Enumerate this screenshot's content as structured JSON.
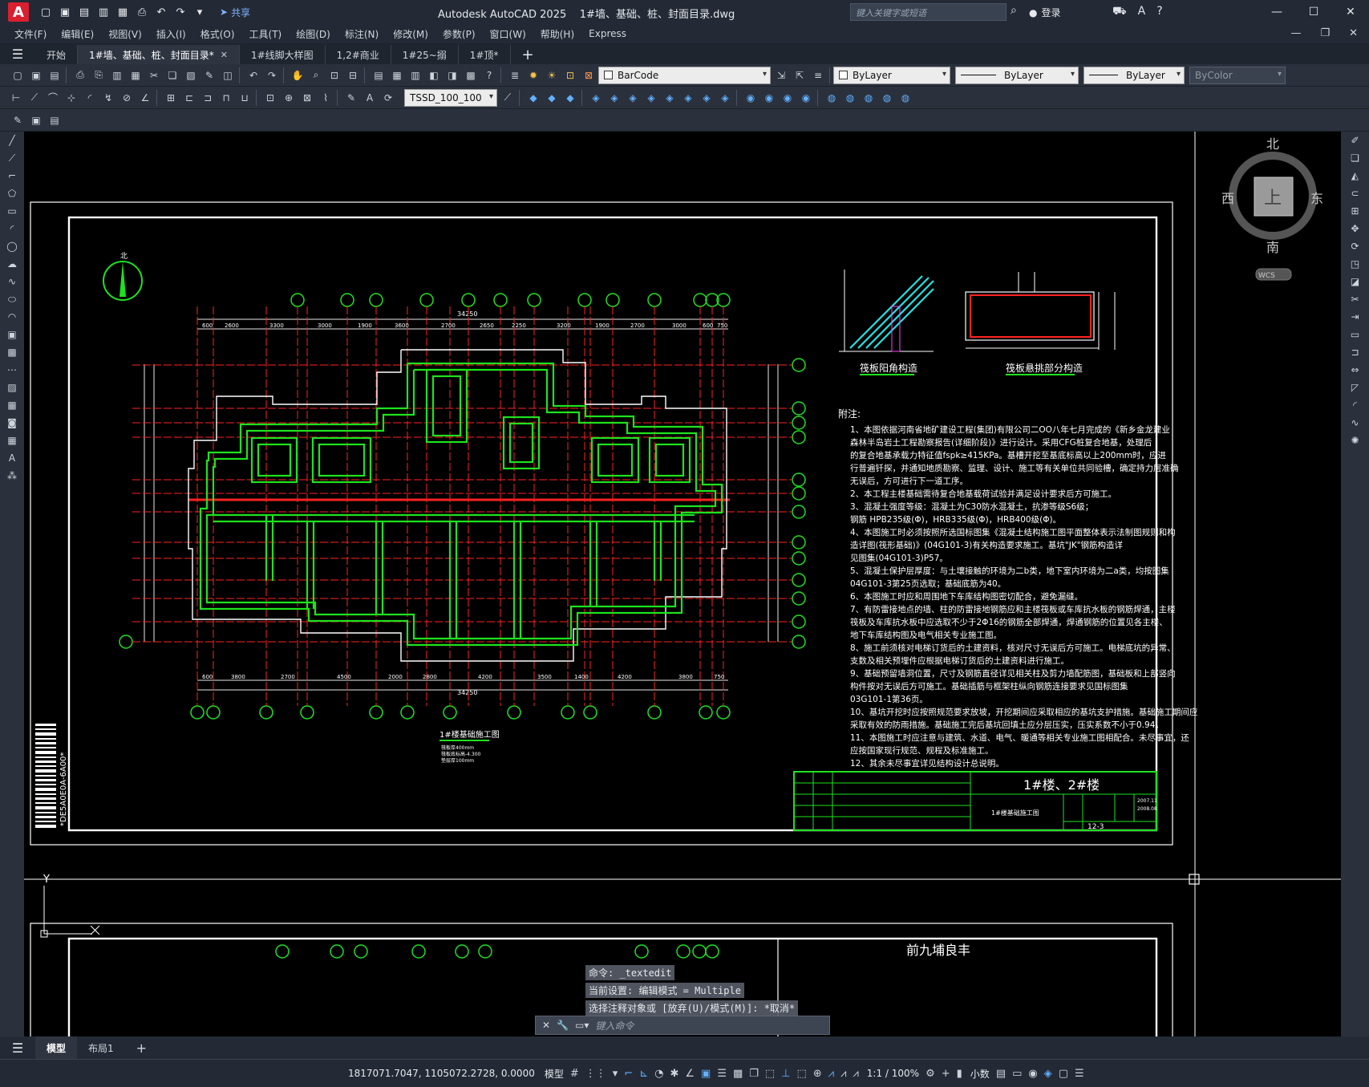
{
  "app": {
    "name": "Autodesk AutoCAD 2025",
    "file": "1#墙、基础、桩、封面目录.dwg",
    "logo_letter": "A"
  },
  "titlebar": {
    "share_label": "共享",
    "search_placeholder": "键入关键字或短语",
    "login_label": "登录"
  },
  "menu": [
    "文件(F)",
    "编辑(E)",
    "视图(V)",
    "插入(I)",
    "格式(O)",
    "工具(T)",
    "绘图(D)",
    "标注(N)",
    "修改(M)",
    "参数(P)",
    "窗口(W)",
    "帮助(H)",
    "Express"
  ],
  "tabs": [
    {
      "label": "开始",
      "active": false
    },
    {
      "label": "1#墙、基础、桩、封面目录*",
      "active": true
    },
    {
      "label": "1#线脚大样图",
      "active": false
    },
    {
      "label": "1,2#商业",
      "active": false
    },
    {
      "label": "1#25~搦",
      "active": false
    },
    {
      "label": "1#顶*",
      "active": false
    }
  ],
  "toolbar": {
    "layer_name": "BarCode",
    "color": "ByLayer",
    "linetype": "ByLayer",
    "lineweight": "ByLayer",
    "plotstyle": "ByColor",
    "dimstyle": "TSSD_100_100"
  },
  "viewcube": {
    "north": "北",
    "south": "南",
    "east": "东",
    "west": "西",
    "face": "上",
    "wcs": "WCS"
  },
  "drawing": {
    "plan_title": "1#楼基础施工图",
    "plan_notes": [
      "筏板厚400mm",
      "筏板底标高-4.300",
      "垫层厚100mm"
    ],
    "total_dim": "34250",
    "detail1_title": "筏板阳角构造",
    "detail2_title": "筏板悬挑部分构造",
    "notes_heading": "附注:",
    "notes": [
      "1、本图依据河南省地矿建设工程(集团)有限公司二OO八年七月完成的《新乡金龙建业",
      "     森林半岛岩土工程勘察报告(详细阶段)》进行设计。采用CFG桩复合地基，处理后",
      "     的复合地基承载力特征值fspk≥415KPa。基槽开挖至基底标高以上200mm时，应进",
      "     行普遍钎探，并通知地质勘察、监理、设计、施工等有关单位共同验槽，确定持力层准确",
      "     无误后，方可进行下一道工序。",
      "2、本工程主楼基础需待复合地基载荷试验并满足设计要求后方可施工。",
      "3、混凝土强度等级：混凝土为C30防水混凝土，抗渗等级S6级；",
      "     钢筋 HPB235级(Φ)，HRB335级(Φ)，HRB400级(Φ)。",
      "4、本图施工时必须按照所选国标图集《混凝土结构施工图平面整体表示法制图规则和构",
      "     造详图(筏形基础)》(04G101-3)有关构造要求施工。基坑\"JK\"钢筋构造详",
      "     见图集(04G101-3)P57。",
      "5、混凝土保护层厚度：与土壤接触的环境为二b类，地下室内环境为二a类，均按图集",
      "     04G101-3第25页选取；基础底筋为40。",
      "6、本图施工时应和周围地下车库结构图密切配合，避免漏缝。",
      "7、有防雷接地点的墙、柱的防雷接地钢筋应和主楼筏板或车库抗水板的钢筋焊通，主楼",
      "     筏板及车库抗水板中应选取不少于2Φ16的钢筋全部焊通，焊通钢筋的位置见各主楼、",
      "     地下车库结构图及电气相关专业施工图。",
      "8、施工前须核对电梯订货后的土建资料，核对尺寸无误后方可施工。电梯底坑的异常、",
      "     支数及相关预埋件应根据电梯订货后的土建资料进行施工。",
      "9、基础预留墙洞位置，尺寸及钢筋直径详见相关柱及剪力墙配筋图，基础板和上部竖向",
      "     构件按对无误后方可施工。基础插筋与框架柱纵向钢筋连接要求见国标图集",
      "     03G101-1第36页。",
      "10、基坑开挖时应按照规范要求放坡，开挖期间应采取相应的基坑支护措施。基础施工期间应",
      "     采取有效的防雨措施。基础施工完后基坑回填土应分层压实，压实系数不小于0.94。",
      "11、本图施工时应注意与建筑、水道、电气、暖通等相关专业施工图相配合。未尽事宜，还",
      "     应按国家现行规范、规程及标准施工。",
      "12、其余未尽事宜详见结构设计总说明。"
    ],
    "titleblock_project": "1#楼、2#楼",
    "titleblock_drawing": "1#楼基础施工图",
    "titleblock_sheet": "12-3",
    "titleblock_dates": [
      "2007.11",
      "2008.08"
    ],
    "barcode_text": "*DE5A0E0A-6A00*",
    "lower_title": "前九埔良丰"
  },
  "command": {
    "history": [
      "命令: _textedit",
      "当前设置: 编辑模式 = Multiple",
      "选择注释对象或 [放弃(U)/模式(M)]: *取消*"
    ],
    "placeholder": "键入命令"
  },
  "layouts": [
    {
      "label": "模型",
      "active": true
    },
    {
      "label": "布局1",
      "active": false
    }
  ],
  "status": {
    "coords": "1817071.7047, 1105072.2728, 0.0000",
    "space": "模型",
    "scale": "1:1 / 100%",
    "units": "小数"
  },
  "colors": {
    "wall_green": "#1ee21e",
    "axis_red": "#ff2222",
    "bubble_green": "#1ee21e",
    "frame_white": "#ffffff",
    "dim_white": "#e8e8e8",
    "cyan": "#29e0e0"
  }
}
